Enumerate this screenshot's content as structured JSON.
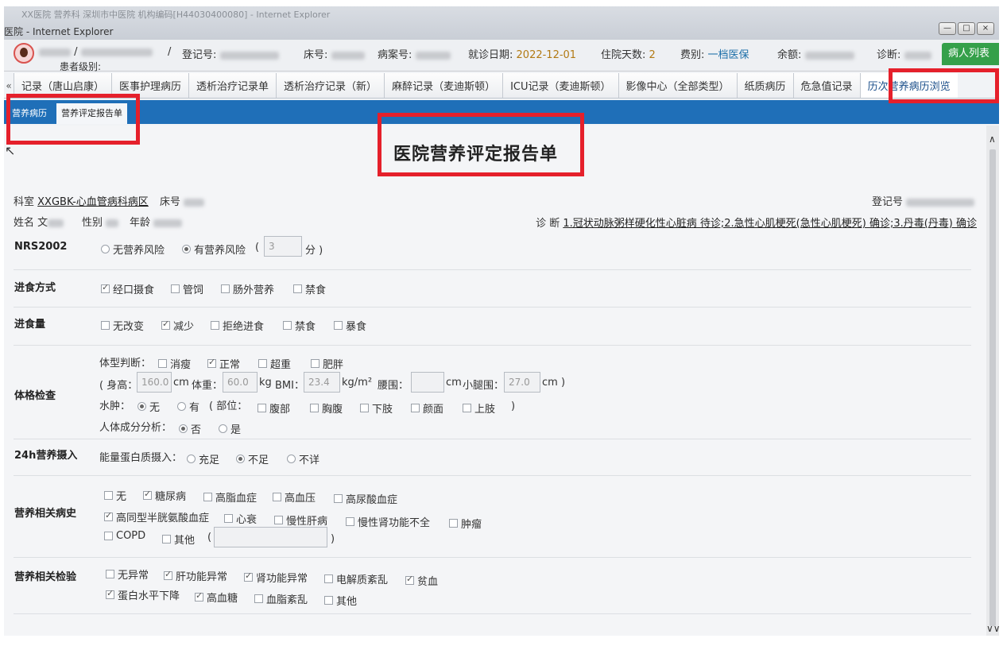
{
  "window": {
    "ghost_title": "XX医院 营养科 深圳市中医院 机构编码[H44030400080] - Internet Explorer",
    "title": "医院 - Internet Explorer",
    "buttons": [
      "—",
      "□",
      "×"
    ]
  },
  "patient": {
    "sep": "/",
    "sep2": "/",
    "level_label": "患者级别:",
    "reg_label": "登记号:",
    "bed_label": "床号:",
    "record_label": "病案号:",
    "visit_date_label": "就诊日期:",
    "visit_date": "2022-12-01",
    "stay_days_label": "住院天数:",
    "stay_days": "2",
    "fee_label": "费别:",
    "fee": "一档医保",
    "balance_label": "余额:",
    "diagnosis_label": "诊断:",
    "patient_list_button": "病人列表"
  },
  "tabs": [
    {
      "label": "记录（唐山启康）"
    },
    {
      "label": "医事护理病历"
    },
    {
      "label": "透析治疗记录单"
    },
    {
      "label": "透析治疗记录（新）"
    },
    {
      "label": "麻醉记录（麦迪斯顿）"
    },
    {
      "label": "ICU记录（麦迪斯顿）"
    },
    {
      "label": "影像中心（全部类型）"
    },
    {
      "label": "纸质病历"
    },
    {
      "label": "危急值记录"
    },
    {
      "label": "历次营养病历浏览"
    }
  ],
  "tab_scroll": "«",
  "subtabs": [
    {
      "label": "营养病历"
    },
    {
      "label": "营养评定报告单"
    }
  ],
  "report": {
    "title": "医院营养评定报告单",
    "dept_label": "科室",
    "dept_value": "XXGBK-心血管病科病区",
    "bed_label": "床号",
    "reg_label": "登记号",
    "name_label": "姓名",
    "name_value": "文",
    "sex_label": "性别",
    "age_label": "年龄",
    "diag_label": "诊  断",
    "diag_value": "1.冠状动脉粥样硬化性心脏病 待诊;2.急性心肌梗死(急性心肌梗死) 确诊;3.丹毒(丹毒) 确诊"
  },
  "nrs2002": {
    "label": "NRS2002",
    "opt_no_risk": "无营养风险",
    "opt_risk": "有营养风险",
    "paren_open": "(",
    "score_value": "3",
    "score_unit": "分 )"
  },
  "intake_method": {
    "label": "进食方式",
    "options": [
      "经口摄食",
      "管饲",
      "肠外营养",
      "禁食"
    ]
  },
  "intake_amount": {
    "label": "进食量",
    "options": [
      "无改变",
      "减少",
      "拒绝进食",
      "禁食",
      "暴食"
    ]
  },
  "physical": {
    "label": "体格检查",
    "body_type_label": "体型判断：",
    "body_types": [
      "消瘦",
      "正常",
      "超重",
      "肥胖"
    ],
    "height_label": "( 身高：",
    "height_value": "160.0",
    "height_unit": "cm",
    "weight_label": "体重：",
    "weight_value": "60.0",
    "weight_unit": "kg",
    "bmi_label": "BMI：",
    "bmi_value": "23.4",
    "bmi_unit": "kg/m²",
    "waist_label": "腰围：",
    "waist_unit": "cm",
    "calf_label": "小腿围：",
    "calf_value": "27.0",
    "calf_unit": "cm )",
    "edema_label": "水肿：",
    "edema_no": "无",
    "edema_yes": "有",
    "site_label": "( 部位：",
    "sites": [
      "腹部",
      "胸腹",
      "下肢",
      "颜面",
      "上肢"
    ],
    "site_close": ")",
    "composition_label": "人体成分分析：",
    "composition_no": "否",
    "composition_yes": "是"
  },
  "intake24": {
    "label": "24h营养摄入",
    "energy_label": "能量蛋白质摄入：",
    "options": [
      "充足",
      "不足",
      "不详"
    ]
  },
  "history": {
    "label": "营养相关病史",
    "row1": [
      "无",
      "糖尿病",
      "高脂血症",
      "高血压",
      "高尿酸血症"
    ],
    "row2": [
      "高同型半胱氨酸血症",
      "心衰",
      "慢性肝病",
      "慢性肾功能不全",
      "肿瘤"
    ],
    "row3": [
      "COPD",
      "其他"
    ],
    "other_open": "(",
    "other_close": ")"
  },
  "tests": {
    "label": "营养相关检验",
    "row1": [
      "无异常",
      "肝功能异常",
      "肾功能异常",
      "电解质紊乱",
      "贫血"
    ],
    "row2": [
      "蛋白水平下降",
      "高血糖",
      "血脂紊乱",
      "其他"
    ]
  },
  "scroll": {
    "up": "∧",
    "down": "∨∨"
  },
  "colors": {
    "highlight": "#e5202b",
    "subbar": "#1f6fb8",
    "patient_btn": "#35a04a"
  }
}
